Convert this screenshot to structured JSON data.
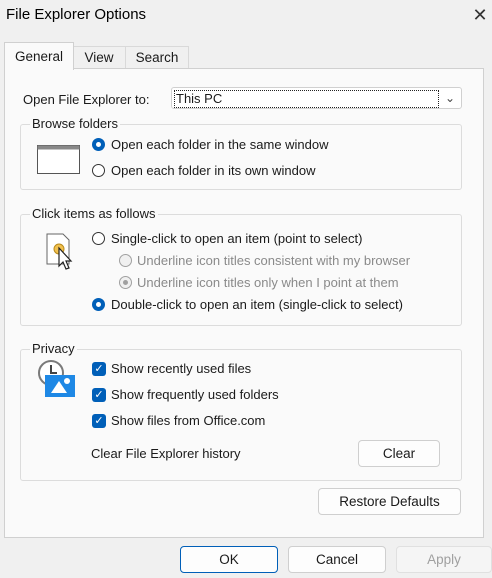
{
  "window": {
    "title": "File Explorer Options",
    "close_symbol": "✕"
  },
  "tabs": [
    {
      "label": "General",
      "active": true
    },
    {
      "label": "View",
      "active": false
    },
    {
      "label": "Search",
      "active": false
    }
  ],
  "open_to": {
    "label": "Open File Explorer to:",
    "value": "This PC"
  },
  "browse_folders": {
    "legend": "Browse folders",
    "options": [
      {
        "label": "Open each folder in the same window",
        "selected": true
      },
      {
        "label": "Open each folder in its own window",
        "selected": false
      }
    ]
  },
  "click_items": {
    "legend": "Click items as follows",
    "single_click": {
      "label": "Single-click to open an item (point to select)",
      "selected": false
    },
    "underline_browser": {
      "label": "Underline icon titles consistent with my browser",
      "selected": false
    },
    "underline_point": {
      "label": "Underline icon titles only when I point at them",
      "selected": true
    },
    "double_click": {
      "label": "Double-click to open an item (single-click to select)",
      "selected": true
    }
  },
  "privacy": {
    "legend": "Privacy",
    "checkboxes": [
      {
        "label": "Show recently used files",
        "checked": true
      },
      {
        "label": "Show frequently used folders",
        "checked": true
      },
      {
        "label": "Show files from Office.com",
        "checked": true
      }
    ],
    "clear_label": "Clear File Explorer history",
    "clear_button": "Clear"
  },
  "restore_defaults": "Restore Defaults",
  "footer": {
    "ok": "OK",
    "cancel": "Cancel",
    "apply": "Apply"
  },
  "colors": {
    "accent": "#005fb8"
  }
}
